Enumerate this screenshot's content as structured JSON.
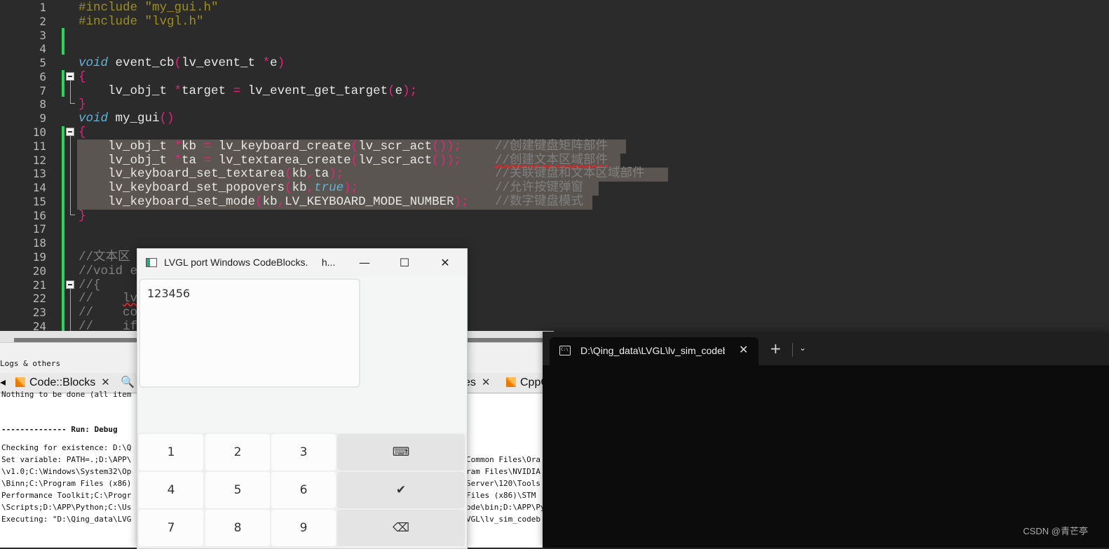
{
  "editor": {
    "line_numbers": [
      "1",
      "2",
      "3",
      "4",
      "5",
      "6",
      "7",
      "8",
      "9",
      "10",
      "11",
      "12",
      "13",
      "14",
      "15",
      "16",
      "17",
      "18",
      "19",
      "20",
      "21",
      "22",
      "23",
      "24"
    ],
    "lines": {
      "l1": "#include \"my_gui.h\"",
      "l2": "#include \"lvgl.h\"",
      "l5_kw": "void",
      "l5_fn": " event_cb",
      "l5_p1": "(",
      "l5_t": "lv_event_t ",
      "l5_star": "*",
      "l5_e": "e",
      "l5_p2": ")",
      "l6": "{",
      "l7_a": "    lv_obj_t ",
      "l7_star": "*",
      "l7_b": "target ",
      "l7_eq": "=",
      "l7_c": " lv_event_get_target",
      "l7_p1": "(",
      "l7_e": "e",
      "l7_p2": ");",
      "l8": "}",
      "l9_kw": "void",
      "l9_fn": " my_gui",
      "l9_p": "()",
      "l10": "{",
      "l11_a": "    lv_obj_t ",
      "l11_star": "*",
      "l11_b": "kb ",
      "l11_eq": "=",
      "l11_c": " lv_keyboard_create",
      "l11_p1": "(",
      "l11_d": "lv_scr_act",
      "l11_p2": "());",
      "l11_cm": "//创建键盘矩阵部件",
      "l12_a": "    lv_obj_t ",
      "l12_star": "*",
      "l12_b": "ta ",
      "l12_eq": "=",
      "l12_c": " lv_textarea_create",
      "l12_p1": "(",
      "l12_d": "lv_scr_act",
      "l12_p2": "());",
      "l12_cm": "//创建文本区域部件",
      "l13_a": "    lv_keyboard_set_textarea",
      "l13_p1": "(",
      "l13_b": "kb",
      "l13_c": ",",
      "l13_d": "ta",
      "l13_p2": ");",
      "l13_cm": "//关联键盘和文本区域部件",
      "l14_a": "    lv_keyboard_set_popovers",
      "l14_p1": "(",
      "l14_b": "kb",
      "l14_c": ",",
      "l14_kw": "true",
      "l14_p2": ");",
      "l14_cm": "//允许按键弹窗",
      "l15_a": "    lv_keyboard_set_mode",
      "l15_p1": "(",
      "l15_b": "kb",
      "l15_c": ",",
      "l15_d": "LV_KEYBOARD_MODE_NUMBER",
      "l15_p2": ");",
      "l15_cm": "//数字键盘模式",
      "l16": "}",
      "l19": "//文本区",
      "l20": "//void ev",
      "l21": "//{",
      "l22_a": "//    ",
      "l22_b": "lv",
      "l23": "//    con",
      "l24": "//    if"
    }
  },
  "bottom_panel": {
    "title": "Logs & others",
    "tabs": {
      "codeblocks": "Code::Blocks",
      "es": "es",
      "cpp": "CppC",
      "close": "✕"
    },
    "log": {
      "l0": "Nothing to be done (all item",
      "l1": "-------------- Run: Debug",
      "l2": "Checking for existence: D:\\Q",
      "l3": "Set variable: PATH=.;D:\\APP\\",
      "l4": "\\v1.0;C:\\Windows\\System32\\Op",
      "l5": "\\Binn;C:\\Program Files (x86)",
      "l6": "Performance Toolkit;C:\\Progr",
      "l7": "\\Scripts;D:\\APP\\Python;C:\\Us",
      "l8": "Executing: \"D:\\Qing_data\\LVG"
    },
    "log_right": {
      "r3": "Common Files\\Ora",
      "r4": "ram Files\\NVIDIA",
      "r5": "Server\\120\\Tools",
      "r6": "Files (x86)\\STM",
      "r7": "ode\\bin;D:\\APP\\Py",
      "r8": "VGL\\lv_sim_codeb"
    }
  },
  "lvgl_window": {
    "title": "LVGL port Windows CodeBlocks.",
    "title_tail": "h...",
    "btn_min": "—",
    "btn_max": "☐",
    "btn_close": "✕",
    "textarea_value": "123456",
    "keys": {
      "k1": "1",
      "k2": "2",
      "k3": "3",
      "kb_icon": "⌨",
      "k4": "4",
      "k5": "5",
      "k6": "6",
      "ok": "✔",
      "k7": "7",
      "k8": "8",
      "k9": "9",
      "bksp": "⌫"
    }
  },
  "terminal": {
    "tab_title": "D:\\Qing_data\\LVGL\\lv_sim_codeblocks_win",
    "icon_text": "C:\\",
    "close": "✕",
    "new_tab": "+",
    "dropdown": "⌄"
  },
  "watermark": "CSDN @青芒亭"
}
